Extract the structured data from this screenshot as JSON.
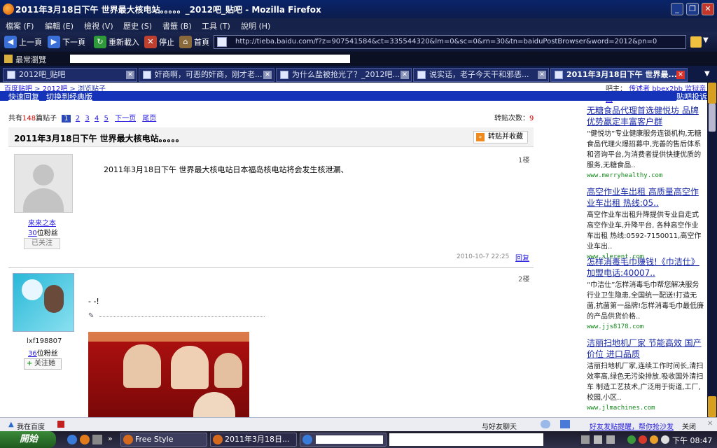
{
  "window": {
    "title": "2011年3月18日下午 世界最大核电站。。。。。_2012吧_贴吧 - Mozilla Firefox",
    "min_label": "_",
    "max_label": "❐",
    "close_label": "✕"
  },
  "menu": [
    "檔案 (F)",
    "編輯 (E)",
    "檢視 (V)",
    "歷史 (S)",
    "書籤 (B)",
    "工具 (T)",
    "說明 (H)"
  ],
  "nav": {
    "back": "上一頁",
    "forward": "下一頁",
    "reload": "重新載入",
    "stop": "停止",
    "home": "首頁",
    "url": "http://tieba.baidu.com/f?z=907541584&ct=335544320&lm=0&sc=0&rn=30&tn=baiduPostBrowser&word=2012&pn=0"
  },
  "bookmarks": {
    "item": "最常瀏覽"
  },
  "tabs": [
    {
      "label": "2012吧_贴吧"
    },
    {
      "label": "奸商啊，可恶的奸商，刚才老..."
    },
    {
      "label": "为什么盐被抢光了？_2012吧..."
    },
    {
      "label": "说实话，老子今天干和邪恶..."
    },
    {
      "label": "2011年3月18日下午 世界最..."
    }
  ],
  "page": {
    "breadcrumb": [
      "百度贴吧",
      "2012吧",
      "浏览贴子"
    ],
    "bluebar_left": [
      "快速回复",
      "切换到经典版"
    ],
    "bluebar_right": "贴吧投诉",
    "owner_label": "吧主：",
    "owners": [
      "传述者",
      "bbex2bb",
      "监狱亲困"
    ],
    "total_prefix": "共有",
    "total_count": "148",
    "total_suffix": "篇贴子",
    "pages": [
      "1",
      "2",
      "3",
      "4",
      "5"
    ],
    "next_page": "下一页",
    "last_page": "尾页",
    "shares_label": "转贴次数：",
    "shares_count": "9",
    "thread_title": "2011年3月18日下午  世界最大核电站。。。。。",
    "collect_button": "转贴并收藏",
    "posts": [
      {
        "floor": "1楼",
        "username": "来来之本",
        "fans_count": "30",
        "fans_label": "位粉丝",
        "follow": "已关注",
        "content": "2011年3月18日下午  世界最大核电站日本福岛核电站将会发生核泄漏、",
        "time": "2010-10-7  22:25",
        "reply": "回复"
      },
      {
        "floor": "2楼",
        "username": "lxf198807",
        "fans_count": "36",
        "fans_label": "位粉丝",
        "follow": "关注她",
        "content": "- -!"
      }
    ]
  },
  "ads": [
    {
      "title": "无糖食品代理首选健悦坊 品牌优势赢定丰富客户群",
      "body": "“健悦坊”专业健康服务连锁机构,无糖食品代理火爆招募中,完善的售后体系和咨询平台,为消费者提供快捷优质的服务,无糖食品..",
      "url": "www.merryhealthy.com"
    },
    {
      "title": "高空作业车出租 高质量高空作业车出租 热线:05..",
      "body": "高空作业车出租升降提供专业自走式高空作业车,升降平台, 各种高空作业车出租 热线:0592-7150011,高空作业车出..",
      "url": "www.slerent.com"
    },
    {
      "title": "怎样消毒毛巾赚钱!《巾洁仕》加盟电话:40007..",
      "body": "“巾洁仕”怎样消毒毛巾帮您解决服务行业卫生隐患,全国统一配送!打造无菌,抗菌第一品牌!怎样消毒毛巾最低廉的产品供货价格..",
      "url": "www.jjs8178.com"
    },
    {
      "title": "洁丽扫地机厂家 节能高效 国产价位 进口品质",
      "body": "洁丽扫地机厂家,连续工作时间长,清扫效率高,绿色无污染排放.吸收国外清扫车 制造工艺技术,广泛用于街道,工厂,校园,小区..",
      "url": "www.jlmachines.com"
    }
  ],
  "statusbar": {
    "left": "我在百度",
    "chat": "与好友聊天",
    "notice": "好友发贴提醒，帮你抢沙发",
    "close": "关闭"
  },
  "taskbar": {
    "start": "開始",
    "items": [
      "Free Style",
      "2011年3月18日..."
    ],
    "clock": "下午 08:47"
  }
}
